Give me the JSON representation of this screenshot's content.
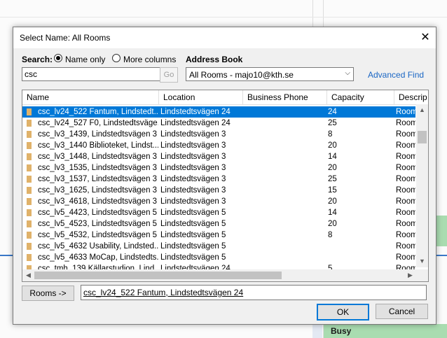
{
  "background": {
    "busy_label": "Busy"
  },
  "dialog": {
    "title": "Select Name: All Rooms",
    "search_label": "Search:",
    "radio_name_only": "Name only",
    "radio_more_columns": "More columns",
    "address_book_label": "Address Book",
    "search_value": "csc",
    "go_label": "Go",
    "address_book_value": "All Rooms - majo10@kth.se",
    "advanced_find": "Advanced Find",
    "columns": [
      "Name",
      "Location",
      "Business Phone",
      "Capacity",
      "Descrip"
    ],
    "rows": [
      {
        "name": "csc_lv24_522 Fantum, Lindstedt...",
        "location": "Lindstedtsvägen 24",
        "capacity": "24",
        "desc": "Room",
        "selected": true
      },
      {
        "name": "csc_lv24_527 F0, Lindstedtsväge...",
        "location": "Lindstedtsvägen 24",
        "capacity": "25",
        "desc": "Room"
      },
      {
        "name": "csc_lv3_1439, Lindstedtsvägen 3",
        "location": "Lindstedtsvägen 3",
        "capacity": "8",
        "desc": "Room"
      },
      {
        "name": "csc_lv3_1440 Biblioteket, Lindst...",
        "location": "Lindstedtsvägen 3",
        "capacity": "20",
        "desc": "Room"
      },
      {
        "name": "csc_lv3_1448, Lindstedtsvägen 3",
        "location": "Lindstedtsvägen 3",
        "capacity": "14",
        "desc": "Room"
      },
      {
        "name": "csc_lv3_1535, Lindstedtsvägen 3",
        "location": "Lindstedtsvägen 3",
        "capacity": "20",
        "desc": "Room"
      },
      {
        "name": "csc_lv3_1537, Lindstedtsvägen 3",
        "location": "Lindstedtsvägen 3",
        "capacity": "25",
        "desc": "Room"
      },
      {
        "name": "csc_lv3_1625, Lindstedtsvägen 3",
        "location": "Lindstedtsvägen 3",
        "capacity": "15",
        "desc": "Room"
      },
      {
        "name": "csc_lv3_4618, Lindstedtsvägen 3",
        "location": "Lindstedtsvägen 3",
        "capacity": "20",
        "desc": "Room"
      },
      {
        "name": "csc_lv5_4423, Lindstedtsvägen 5",
        "location": "Lindstedtsvägen 5",
        "capacity": "14",
        "desc": "Room"
      },
      {
        "name": "csc_lv5_4523, Lindstedtsvägen 5",
        "location": "Lindstedtsvägen 5",
        "capacity": "20",
        "desc": "Room"
      },
      {
        "name": "csc_lv5_4532, Lindstedtsvägen 5",
        "location": "Lindstedtsvägen 5",
        "capacity": "8",
        "desc": "Room"
      },
      {
        "name": "csc_lv5_4632 Usability, Lindsted...",
        "location": "Lindstedtsvägen 5",
        "capacity": "",
        "desc": "Room"
      },
      {
        "name": "csc_lv5_4633 MoCap, Lindstedts...",
        "location": "Lindstedtsvägen 5",
        "capacity": "",
        "desc": "Room"
      },
      {
        "name": "csc_tmh_139 Källarstudion, Lind...",
        "location": "Lindstedtsvägen 24",
        "capacity": "5",
        "desc": "Room"
      }
    ],
    "rooms_button": "Rooms ->",
    "rooms_value": "csc_lv24_522 Fantum, Lindstedtsvägen 24",
    "ok_label": "OK",
    "cancel_label": "Cancel"
  },
  "colors": {
    "selection": "#0078d7",
    "link": "#1a66c4",
    "room_icon": "#e0b26a",
    "busy_green": "#a9dcb0"
  },
  "icons": {
    "close": "close-icon",
    "dropdown": "chevron-down-icon",
    "room": "room-icon"
  }
}
